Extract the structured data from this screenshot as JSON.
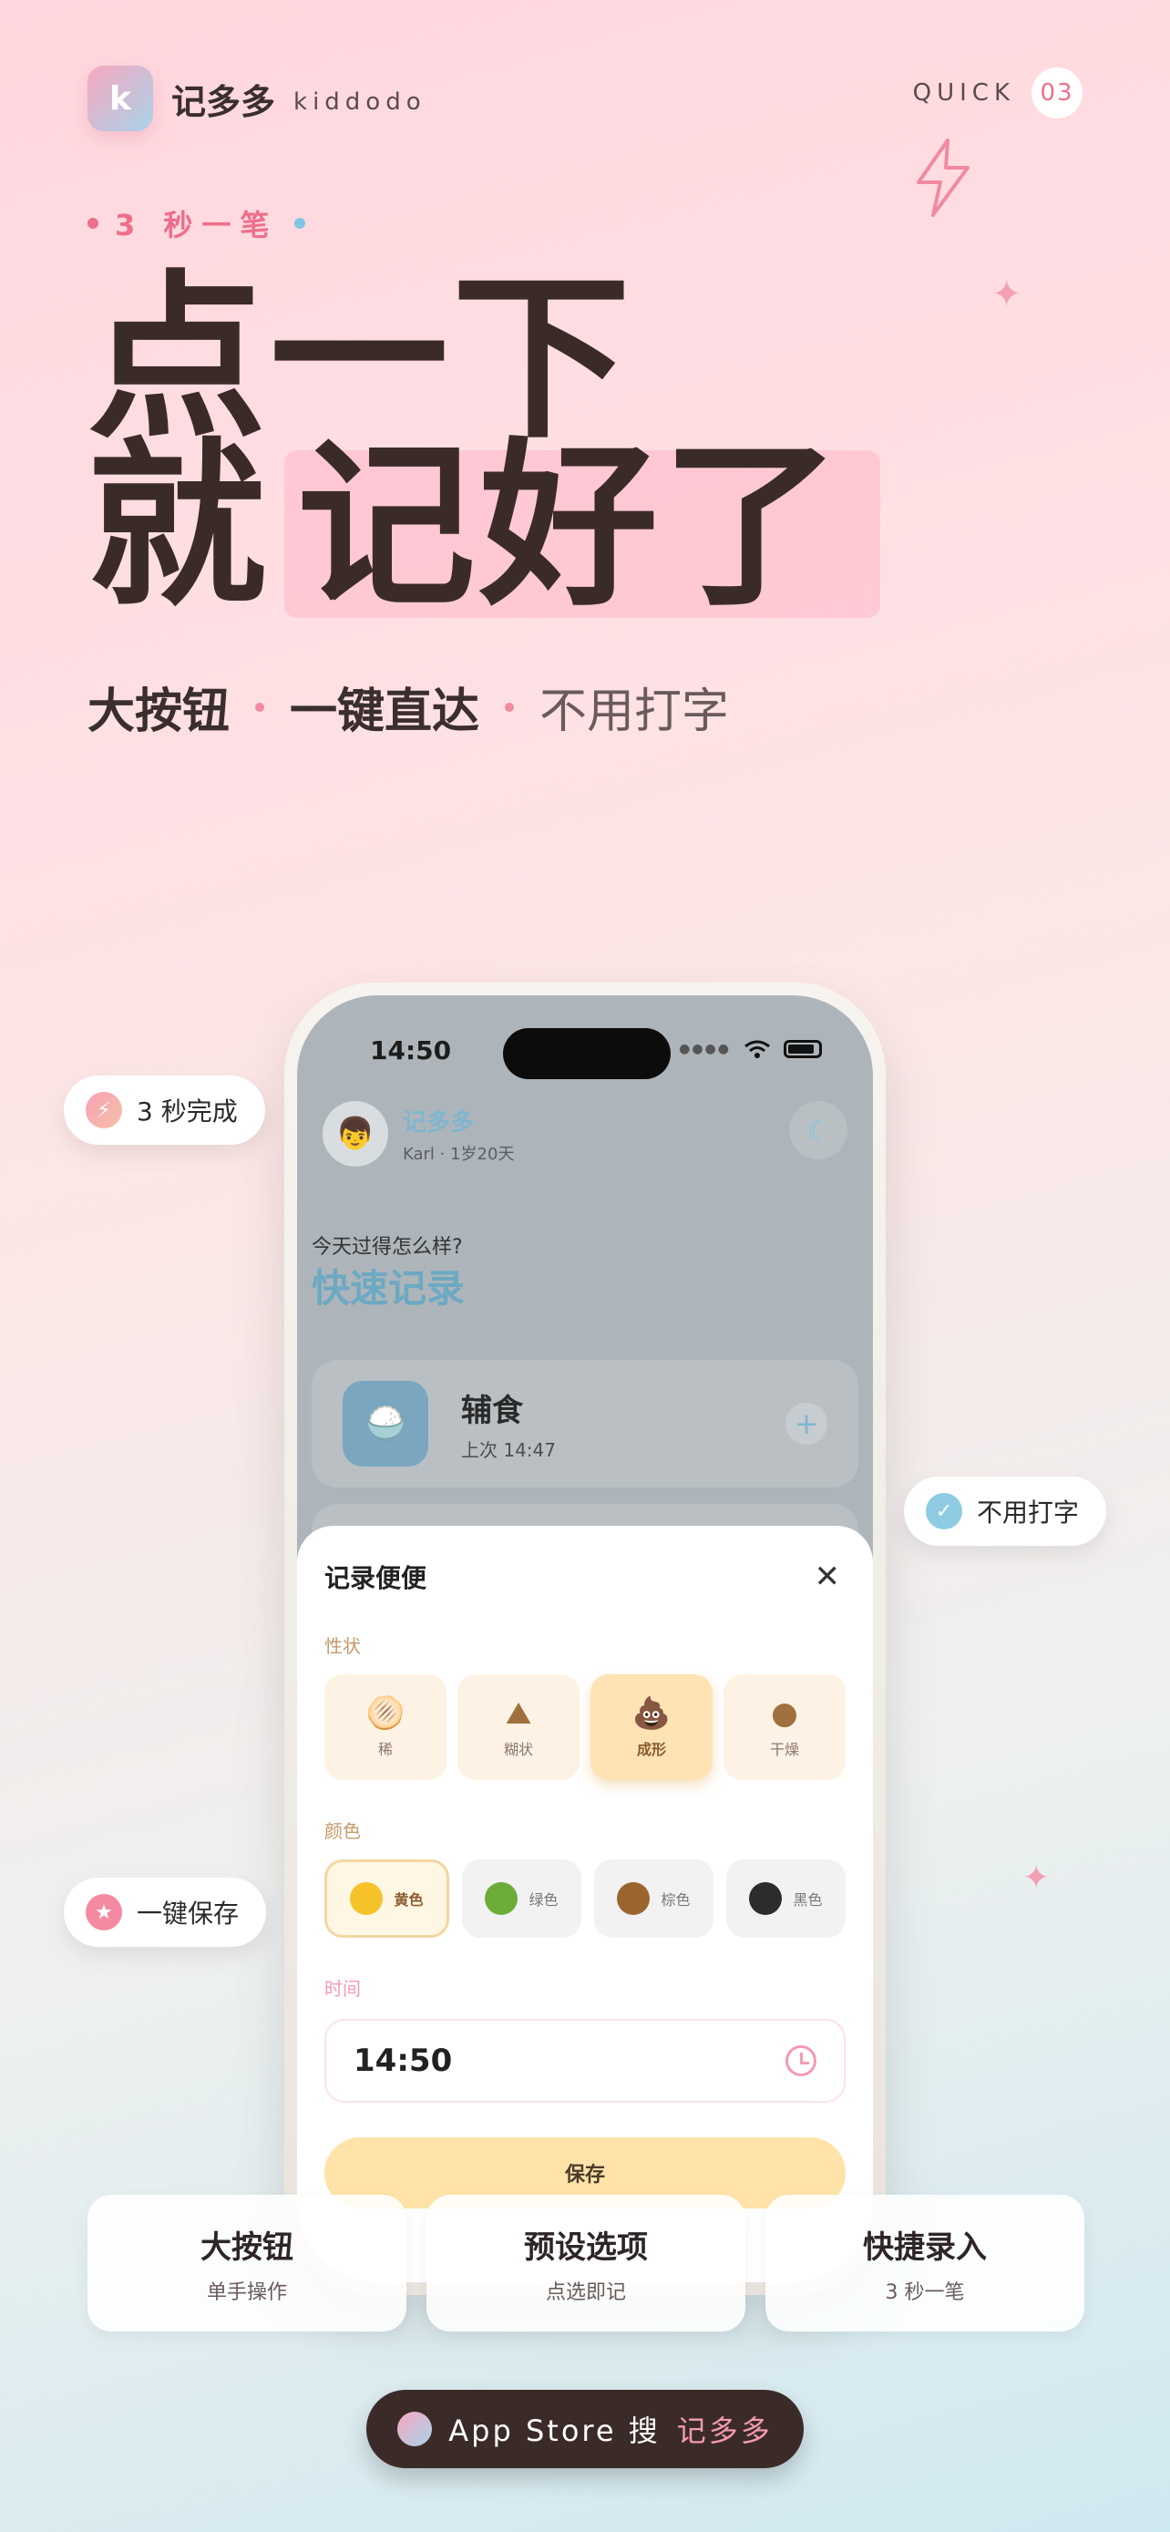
{
  "brand": {
    "logo_letter": "k",
    "name": "记多多",
    "sub": "kiddodo"
  },
  "quick": {
    "label": "QUICK",
    "number": "03"
  },
  "tagline": "3 秒一笔",
  "headline": {
    "line1": "点一下",
    "line2_a": "就",
    "line2_b": "记好了"
  },
  "subline": {
    "a": "大按钮",
    "b": "一键直达",
    "c": "不用打字"
  },
  "phone": {
    "time": "14:50",
    "app_name": "记多多",
    "user": "Karl · 1岁20天",
    "greeting": "今天过得怎么样?",
    "greeting_title": "快速记录",
    "card": {
      "title": "辅食",
      "sub": "上次 14:47"
    },
    "sheet": {
      "title": "记录便便",
      "shape_label": "性状",
      "shapes": [
        {
          "label": "稀",
          "icon": "🫓"
        },
        {
          "label": "糊状",
          "icon": "⛰"
        },
        {
          "label": "成形",
          "icon": "💩"
        },
        {
          "label": "干燥",
          "icon": "●"
        }
      ],
      "selected_shape": "成形",
      "color_label": "颜色",
      "colors": [
        {
          "label": "黄色",
          "hex": "#f5c229"
        },
        {
          "label": "绿色",
          "hex": "#6cad3a"
        },
        {
          "label": "棕色",
          "hex": "#9b6530"
        },
        {
          "label": "黑色",
          "hex": "#2c2c2c"
        }
      ],
      "selected_color": "黄色",
      "time_label": "时间",
      "time_value": "14:50",
      "save": "保存"
    }
  },
  "pills": {
    "p1": "3 秒完成",
    "p2": "不用打字",
    "p3": "一键保存"
  },
  "features": [
    {
      "title": "大按钮",
      "sub": "单手操作"
    },
    {
      "title": "预设选项",
      "sub": "点选即记"
    },
    {
      "title": "快捷录入",
      "sub": "3 秒一笔"
    }
  ],
  "cta": {
    "text": "App Store 搜",
    "brand": "记多多"
  },
  "colors": {
    "accent_pink": "#ee6f8b",
    "accent_blue": "#7fc6e3",
    "dark": "#3b2b28"
  }
}
